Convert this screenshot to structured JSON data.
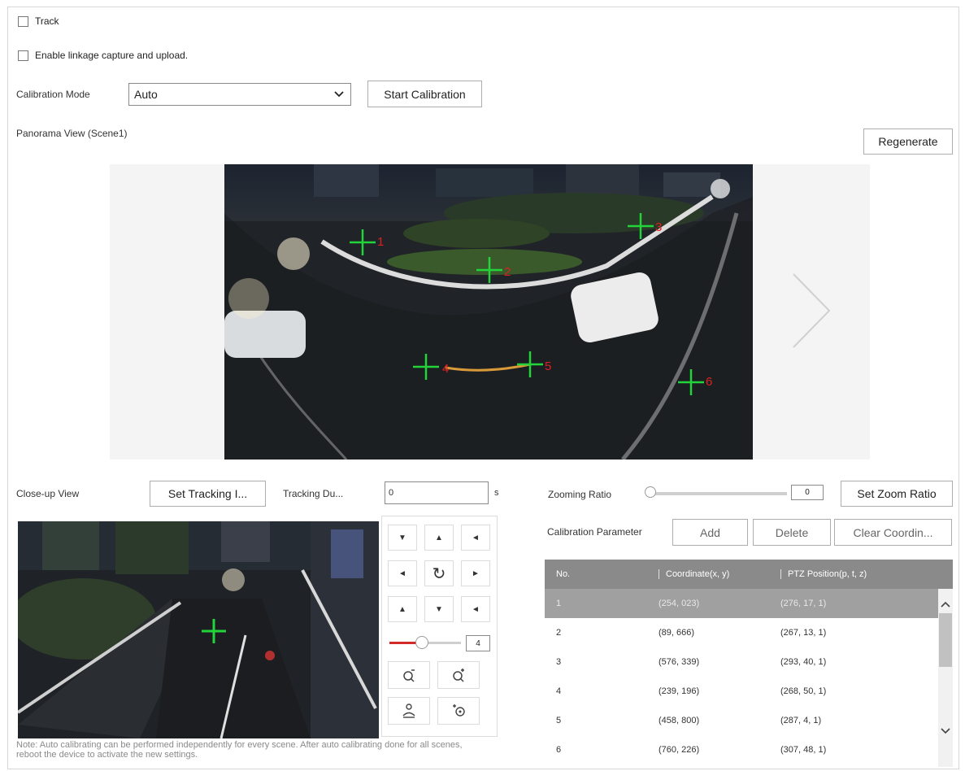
{
  "track": {
    "label": "Track",
    "checked": false
  },
  "linkage": {
    "label": "Enable linkage capture and upload.",
    "checked": false
  },
  "calibration": {
    "mode_label": "Calibration Mode",
    "mode_value": "Auto",
    "start_button": "Start Calibration"
  },
  "panorama": {
    "title": "Panorama View (Scene1)",
    "regenerate_button": "Regenerate",
    "markers": [
      {
        "label": "1"
      },
      {
        "label": "2"
      },
      {
        "label": "3"
      },
      {
        "label": "4"
      },
      {
        "label": "5"
      },
      {
        "label": "6"
      }
    ]
  },
  "closeup": {
    "title": "Close-up View",
    "set_tracking_button": "Set Tracking I...",
    "tracking_duration_label": "Tracking Du...",
    "tracking_duration_value": "0",
    "tracking_duration_unit": "s"
  },
  "zoom": {
    "label": "Zooming Ratio",
    "value": "0",
    "set_button": "Set Zoom Ratio",
    "slider_fraction": 0
  },
  "ptz": {
    "speed_value": "4",
    "speed_fraction": 0.45,
    "arrows": {
      "up_left": "▼",
      "up": "▲",
      "up_right": "◄",
      "left": "◄",
      "auto": "↻",
      "right": "►",
      "down_left": "▲",
      "down": "▼",
      "down_right": "◄"
    }
  },
  "calib_param": {
    "label": "Calibration Parameter",
    "add_button": "Add",
    "delete_button": "Delete",
    "clear_button": "Clear Coordin..."
  },
  "table": {
    "headers": [
      "No.",
      "Coordinate(x, y)",
      "PTZ Position(p, t, z)"
    ],
    "rows": [
      {
        "no": "1",
        "coord": "(254, 023)",
        "ptz": "(276, 17, 1)",
        "selected": true
      },
      {
        "no": "2",
        "coord": "(89, 666)",
        "ptz": "(267, 13, 1)"
      },
      {
        "no": "3",
        "coord": "(576, 339)",
        "ptz": "(293, 40, 1)"
      },
      {
        "no": "4",
        "coord": "(239, 196)",
        "ptz": "(268, 50, 1)"
      },
      {
        "no": "5",
        "coord": "(458, 800)",
        "ptz": "(287, 4, 1)"
      },
      {
        "no": "6",
        "coord": "(760, 226)",
        "ptz": "(307, 48, 1)"
      }
    ]
  },
  "note": "Note: Auto calibrating can be performed independently for every scene. After auto calibrating done for all scenes, reboot the device to activate the new settings.",
  "colors": {
    "marker_green": "#22d43a",
    "marker_red": "#e02020",
    "table_header": "#8a8a8a",
    "selected_row": "#a0a0a0",
    "slider_red": "#d42a2a"
  }
}
